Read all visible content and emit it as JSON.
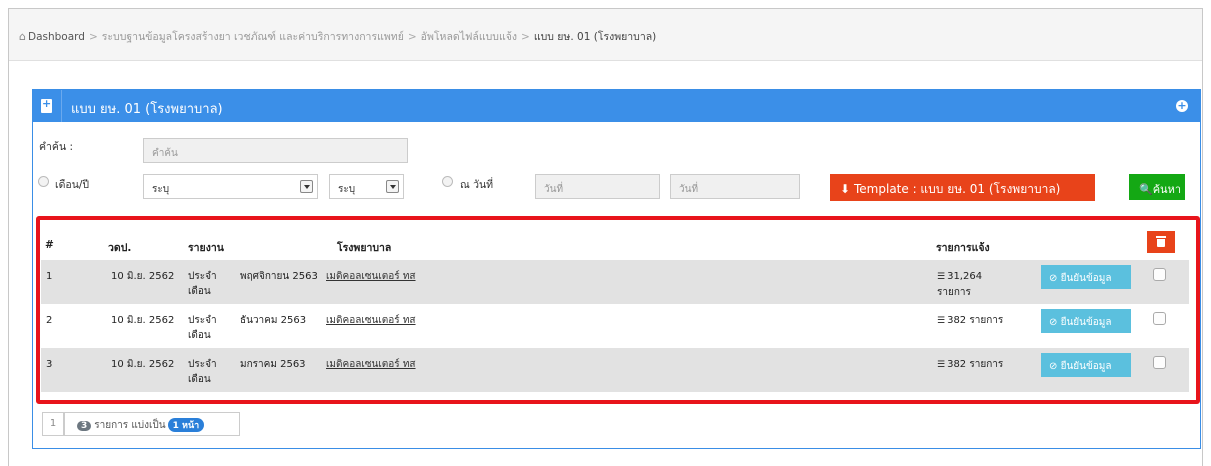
{
  "breadcrumb": {
    "home": "Dashboard",
    "items": [
      "ระบบฐานข้อมูลโครงสร้างยา เวชภัณฑ์ และค่าบริการทางการแพทย์",
      "อัพโหลดไฟล์แบบแจ้ง"
    ],
    "current": "แบบ ยษ. 01 (โรงพยาบาล)"
  },
  "panel": {
    "title": "แบบ ยษ. 01 (โรงพยาบาล)"
  },
  "search": {
    "label": "คำค้น :",
    "placeholder": "คำค้น",
    "month_year_label": "เดือน/ปี",
    "month_select": "ระบุ",
    "year_select": "ระบุ",
    "date_label": "ณ วันที่",
    "date_from_placeholder": "วันที่",
    "date_to_placeholder": "วันที่",
    "template_button": "Template : แบบ ยษ. 01 (โรงพยาบาล)",
    "search_button": "ค้นหา"
  },
  "table": {
    "headers": {
      "num": "#",
      "date": "วดป.",
      "report": "รายงาน",
      "hospital": "โรงพยาบาล",
      "items": "รายการแจ้ง"
    },
    "rows": [
      {
        "num": "1",
        "date": "10 มิ.ย. 2562",
        "type": "ประจำ เดือน",
        "period": "พฤศจิกายน 2563",
        "hospital": "เมดิคอลเซนเตอร์ ทส",
        "items": "31,264 รายการ",
        "confirm": "ยืนยันข้อมูล"
      },
      {
        "num": "2",
        "date": "10 มิ.ย. 2562",
        "type": "ประจำ เดือน",
        "period": "ธันวาคม 2563",
        "hospital": "เมดิคอลเซนเตอร์ ทส",
        "items": "382 รายการ",
        "confirm": "ยืนยันข้อมูล"
      },
      {
        "num": "3",
        "date": "10 มิ.ย. 2562",
        "type": "ประจำ เดือน",
        "period": "มกราคม 2563",
        "hospital": "เมดิคอลเซนเตอร์ ทส",
        "items": "382 รายการ",
        "confirm": "ยืนยันข้อมูล"
      }
    ]
  },
  "pager": {
    "page": "1",
    "count": "3",
    "text": "รายการ แบ่งเป็น",
    "pages": "1 หน้า"
  },
  "colors": {
    "panel_header": "#3b8fe8",
    "template_button": "#e8431a",
    "search_button": "#14a814",
    "confirm_button": "#5bc0de",
    "highlight_border": "#e8141b"
  }
}
